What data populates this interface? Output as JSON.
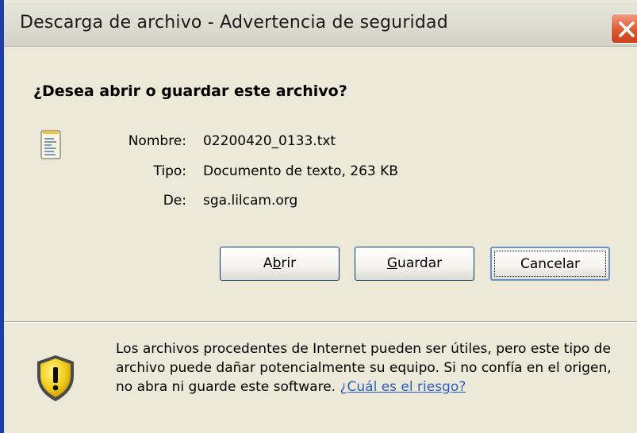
{
  "window": {
    "title": "Descarga de archivo - Advertencia de seguridad",
    "close_icon": "close-x-icon"
  },
  "question": "¿Desea abrir o guardar este archivo?",
  "file": {
    "icon": "text-file-icon",
    "name_label": "Nombre:",
    "name_value": "02200420_0133.txt",
    "type_label": "Tipo:",
    "type_value": "Documento de texto, 263 KB",
    "from_label": "De:",
    "from_value": "sga.lilcam.org"
  },
  "buttons": {
    "open": {
      "label_pre": "A",
      "label_accel": "b",
      "label_post": "rir"
    },
    "save": {
      "label_pre": "",
      "label_accel": "G",
      "label_post": "uardar"
    },
    "cancel": {
      "label": "Cancelar"
    }
  },
  "warning": {
    "icon": "security-shield-warning-icon",
    "text": "Los archivos procedentes de Internet pueden ser útiles, pero este tipo de archivo puede dañar potencialmente su equipo. Si no confía en el origen, no abra ni guarde este software.",
    "link": "¿Cuál es el riesgo?"
  },
  "colors": {
    "dialog_bg": "#ECE9D8",
    "close_button": "#E0582F",
    "link": "#2A5CC8",
    "window_border": "#1F3DA8"
  }
}
